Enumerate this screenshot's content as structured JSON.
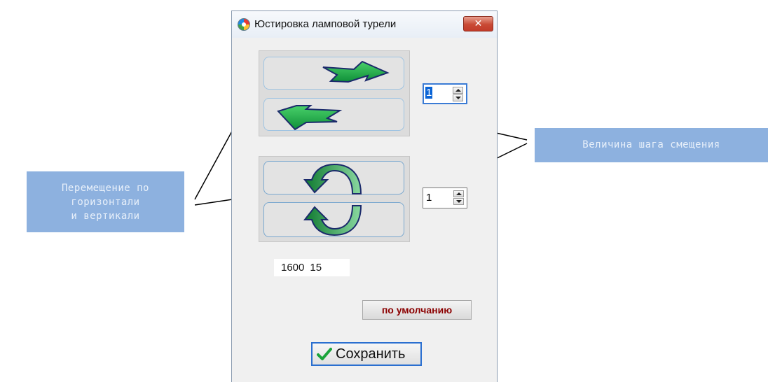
{
  "window": {
    "title": "Юстировка ламповой турели",
    "close_label": "✕"
  },
  "move": {
    "forward_button": "move-forward",
    "back_button": "move-back",
    "step_value": "1"
  },
  "rotate": {
    "cw_button": "rotate-clockwise",
    "ccw_button": "rotate-counterclockwise",
    "step_value": "1"
  },
  "readout": {
    "value_a": "1600",
    "value_b": "15"
  },
  "buttons": {
    "default_label": "по умолчанию",
    "save_label": "Сохранить"
  },
  "callouts": {
    "left_lines": [
      "Перемещение по",
      "горизонтали",
      "и вертикали"
    ],
    "right_text": "Величина шага смещения"
  },
  "colors": {
    "callout_bg": "#8db1df",
    "arrow_green": "#1fae4a",
    "arrow_outline": "#1b2a6b",
    "default_text": "#8b0000",
    "focus_blue": "#2a6fd0"
  }
}
